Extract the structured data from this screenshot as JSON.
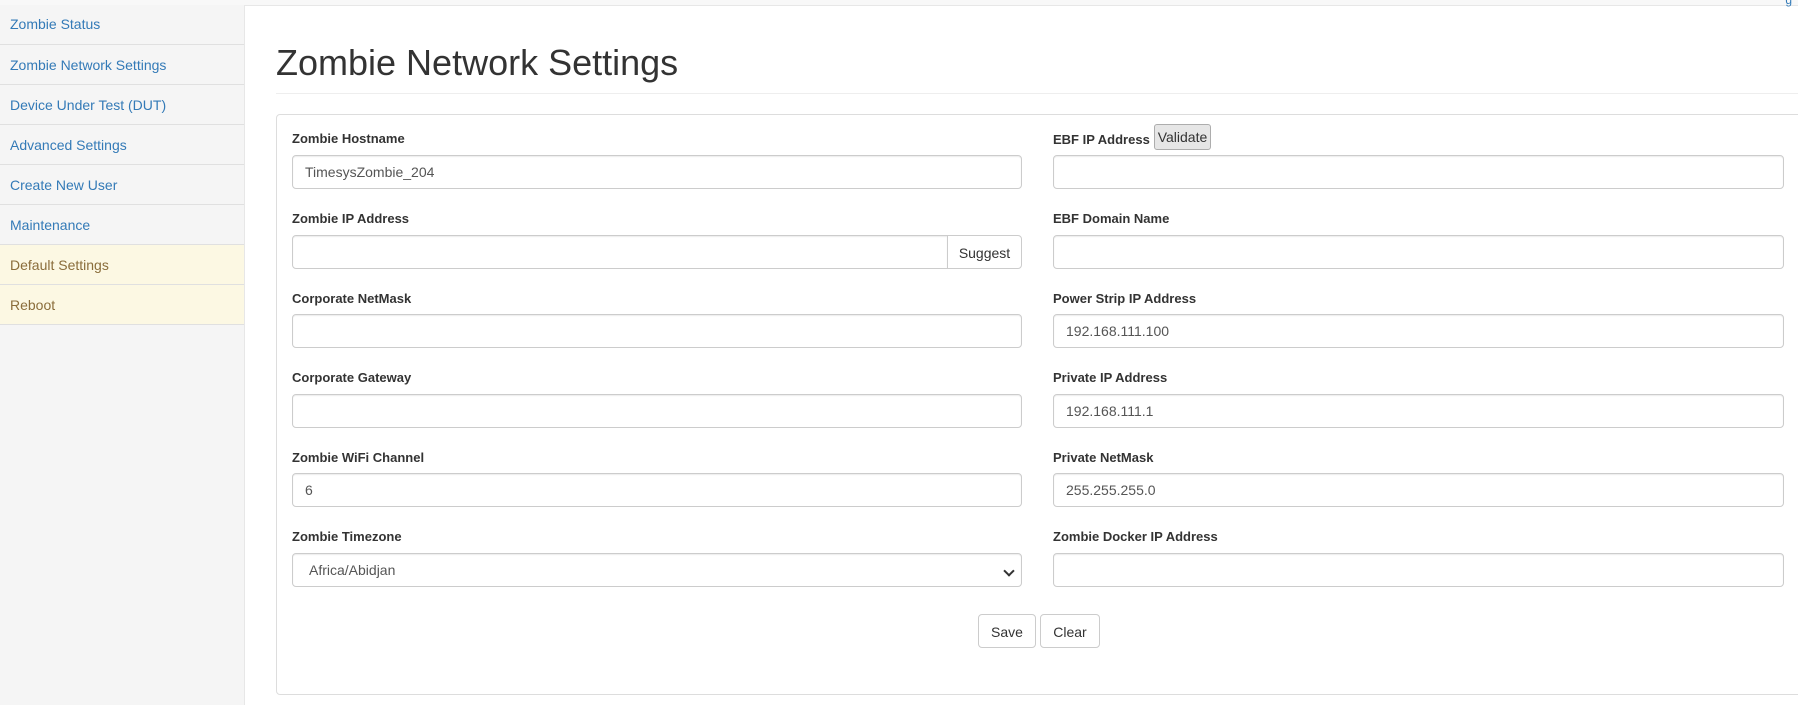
{
  "sidebar": {
    "items": [
      {
        "label": "Zombie Status"
      },
      {
        "label": "Zombie Network Settings"
      },
      {
        "label": "Device Under Test (DUT)"
      },
      {
        "label": "Advanced Settings"
      },
      {
        "label": "Create New User"
      },
      {
        "label": "Maintenance"
      },
      {
        "label": "Default Settings"
      },
      {
        "label": "Reboot"
      }
    ]
  },
  "header": {
    "page_title": "Zombie Network Settings"
  },
  "form": {
    "left": {
      "hostname": {
        "label": "Zombie Hostname",
        "value": "TimesysZombie_204"
      },
      "ip_address": {
        "label": "Zombie IP Address",
        "value": "",
        "suggest_label": "Suggest"
      },
      "corp_netmask": {
        "label": "Corporate NetMask",
        "value": ""
      },
      "corp_gateway": {
        "label": "Corporate Gateway",
        "value": ""
      },
      "wifi_channel": {
        "label": "Zombie WiFi Channel",
        "value": "6"
      },
      "timezone": {
        "label": "Zombie Timezone",
        "value": "Africa/Abidjan"
      }
    },
    "right": {
      "ebf_ip": {
        "label": "EBF IP Address",
        "value": "",
        "validate_label": "Validate"
      },
      "ebf_domain": {
        "label": "EBF Domain Name",
        "value": ""
      },
      "power_strip_ip": {
        "label": "Power Strip IP Address",
        "value": "192.168.111.100"
      },
      "private_ip": {
        "label": "Private IP Address",
        "value": "192.168.111.1"
      },
      "private_netmask": {
        "label": "Private NetMask",
        "value": "255.255.255.0"
      },
      "docker_ip": {
        "label": "Zombie Docker IP Address",
        "value": ""
      }
    },
    "actions": {
      "save_label": "Save",
      "clear_label": "Clear"
    }
  },
  "colors": {
    "link": "#337ab7",
    "warning_bg": "#fcf8e3",
    "warning_text": "#8a6d3b"
  }
}
